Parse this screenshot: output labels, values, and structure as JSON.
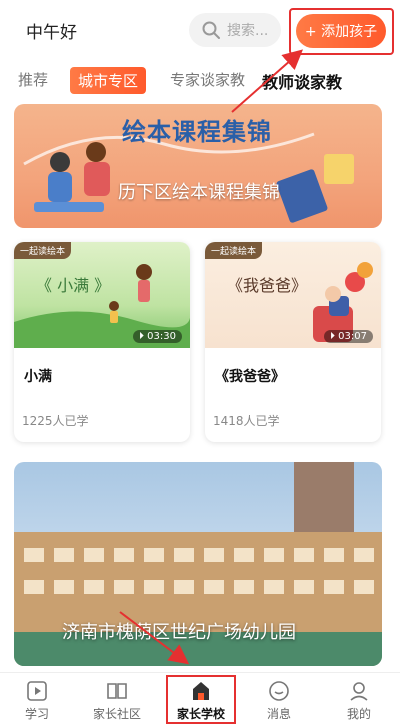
{
  "header": {
    "greeting": "中午好",
    "search_placeholder": "搜索...",
    "add_child_label": "+ 添加孩子"
  },
  "tabs": [
    {
      "label": "推荐"
    },
    {
      "label": "城市专区"
    },
    {
      "label": "专家谈家教"
    },
    {
      "label": "教师谈家教"
    }
  ],
  "banner": {
    "top_title": "绘本课程集锦",
    "caption": "历下区绘本课程集锦"
  },
  "cards": [
    {
      "badge": "一起读绘本",
      "book_title": "《 小满 》",
      "duration": "03:30",
      "title": "小满",
      "learners": "1225人已学"
    },
    {
      "badge": "一起读绘本",
      "book_title": "《我爸爸》",
      "duration": "03:07",
      "title": "《我爸爸》",
      "learners": "1418人已学"
    }
  ],
  "photo": {
    "caption": "济南市槐荫区世纪广场幼儿园"
  },
  "bottom_nav": [
    {
      "label": "学习",
      "icon": "video-icon"
    },
    {
      "label": "家长社区",
      "icon": "book-icon"
    },
    {
      "label": "家长学校",
      "icon": "school-icon"
    },
    {
      "label": "消息",
      "icon": "chat-icon"
    },
    {
      "label": "我的",
      "icon": "user-icon"
    }
  ],
  "colors": {
    "accent": "#ff5a2c",
    "highlight": "#e53030"
  }
}
